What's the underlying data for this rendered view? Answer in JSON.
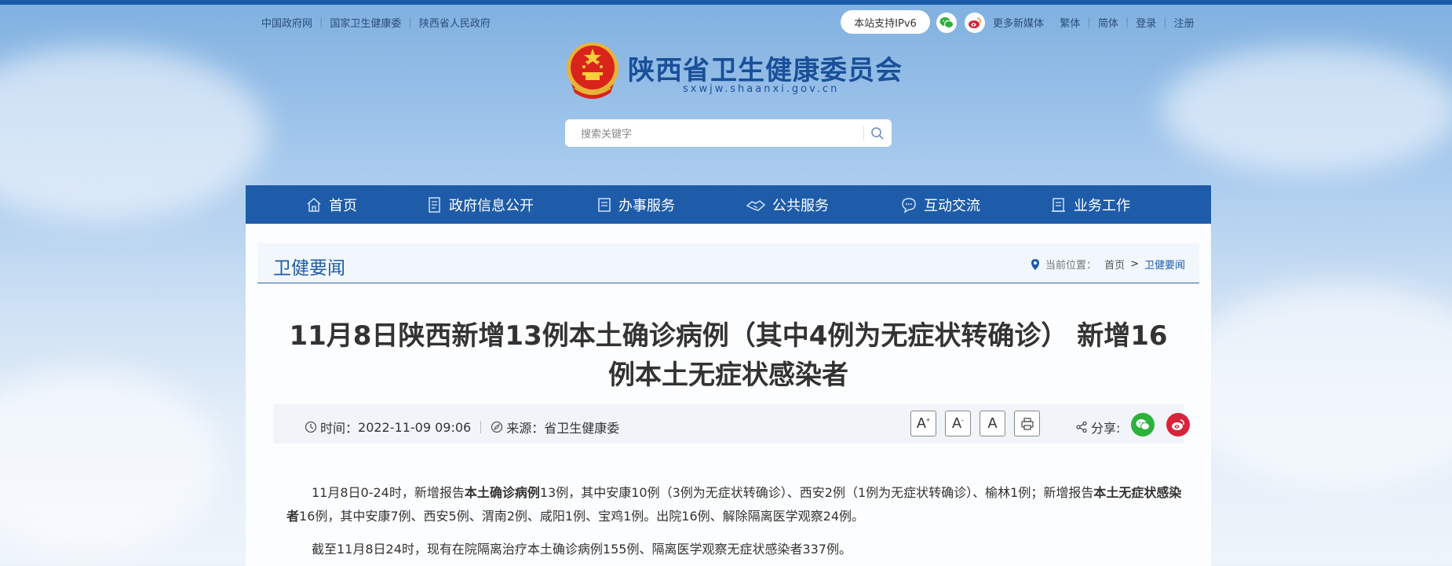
{
  "top_links": [
    "中国政府网",
    "国家卫生健康委",
    "陕西省人民政府"
  ],
  "ipv6_label": "本站支持IPv6",
  "right_links": [
    "更多新媒体",
    "繁体",
    "简体",
    "登录",
    "注册"
  ],
  "site": {
    "title": "陕西省卫生健康委员会",
    "domain": "sxwjw.shaanxi.gov.cn"
  },
  "search": {
    "placeholder": "搜索关键字"
  },
  "nav": [
    "首页",
    "政府信息公开",
    "办事服务",
    "公共服务",
    "互动交流",
    "业务工作"
  ],
  "section_title": "卫健要闻",
  "breadcrumb": {
    "label": "当前位置：",
    "home": "首页",
    "arrow": ">",
    "current": "卫健要闻"
  },
  "article": {
    "title_line1": "11月8日陕西新增13例本土确诊病例（其中4例为无症状转确诊） 新增16",
    "title_line2": "例本土无症状感染者",
    "time_label": "时间：",
    "time_value": "2022-11-09 09:06",
    "source_label": "来源：",
    "source_value": "省卫生健康委",
    "font_buttons": [
      "A",
      "A",
      "A"
    ],
    "font_sup": [
      "+",
      "-"
    ],
    "share_label": "分享:",
    "p1": {
      "a": "11月8日0-24时，新增报告",
      "b": "本土确诊病例",
      "c": "13例，其中安康10例（3例为无症状转确诊）、西安2例（1例为无症状转确诊）、榆林1例；新增报告",
      "d": "本土无症状感染者",
      "e": "16例，其中安康7例、西安5例、渭南2例、咸阳1例、宝鸡1例。出院16例、解除隔离医学观察24例。"
    },
    "p2": "截至11月8日24时，现有在院隔离治疗本土确诊病例155例、隔离医学观察无症状感染者337例。"
  },
  "colors": {
    "brand_blue": "#1e5ca9",
    "wechat_green": "#2bb23b",
    "weibo_red": "#d8233a"
  }
}
